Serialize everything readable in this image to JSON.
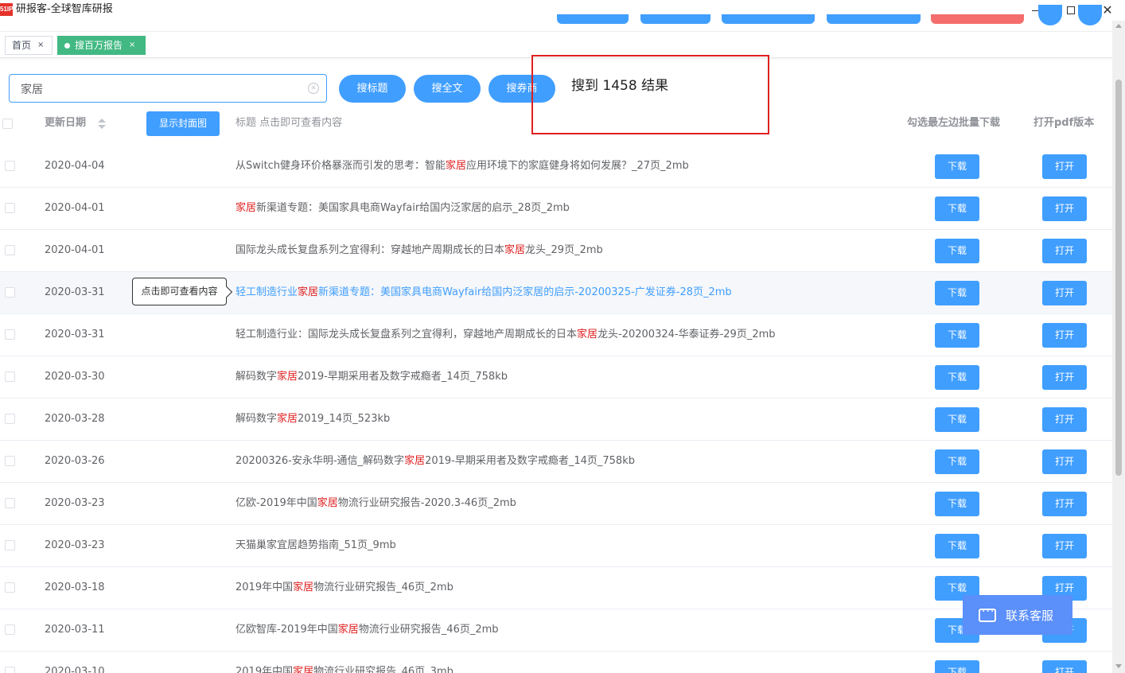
{
  "window": {
    "logo_text": "51IP",
    "title": "研报客-全球智库研报",
    "close_glyph": "✕"
  },
  "tabs": [
    {
      "label": "首页",
      "close": "×"
    },
    {
      "label": "搜百万报告",
      "close": "×",
      "active": true
    }
  ],
  "search": {
    "value": "家居",
    "clear_glyph": "×",
    "btn_title": "搜标题",
    "btn_fulltext": "搜全文",
    "btn_broker": "搜券商",
    "result_text": "搜到 1458 结果"
  },
  "table": {
    "col_date": "更新日期",
    "cover_button": "显示封面图",
    "col_title": "标题 点击即可查看内容",
    "col_batch": "勾选最左边批量下载",
    "col_pdf": "打开pdf版本",
    "download_label": "下载",
    "open_label": "打开",
    "tooltip": "点击即可查看内容",
    "rows": [
      {
        "date": "2020-04-04",
        "pre": "从Switch健身环价格暴涨而引发的思考：智能",
        "hl": "家居",
        "post": "应用环境下的家庭健身将如何发展？_27页_2mb"
      },
      {
        "date": "2020-04-01",
        "pre": "",
        "hl": "家居",
        "post": "新渠道专题：美国家具电商Wayfair给国内泛家居的启示_28页_2mb"
      },
      {
        "date": "2020-04-01",
        "pre": "国际龙头成长复盘系列之宜得利：穿越地产周期成长的日本",
        "hl": "家居",
        "post": "龙头_29页_2mb"
      },
      {
        "date": "2020-03-31",
        "pre": "轻工制造行业",
        "hl": "家居",
        "post": "新渠道专题：美国家具电商Wayfair给国内泛家居的启示-20200325-广发证券-28页_2mb",
        "hover": true
      },
      {
        "date": "2020-03-31",
        "pre": "轻工制造行业：国际龙头成长复盘系列之宜得利，穿越地产周期成长的日本",
        "hl": "家居",
        "post": "龙头-20200324-华泰证券-29页_2mb"
      },
      {
        "date": "2020-03-30",
        "pre": "解码数字",
        "hl": "家居",
        "post": "2019-早期采用者及数字戒瘾者_14页_758kb"
      },
      {
        "date": "2020-03-28",
        "pre": "解码数字",
        "hl": "家居",
        "post": "2019_14页_523kb"
      },
      {
        "date": "2020-03-26",
        "pre": "20200326-安永华明-通信_解码数字",
        "hl": "家居",
        "post": "2019-早期采用者及数字戒瘾者_14页_758kb"
      },
      {
        "date": "2020-03-23",
        "pre": "亿欧-2019年中国",
        "hl": "家居",
        "post": "物流行业研究报告-2020.3-46页_2mb"
      },
      {
        "date": "2020-03-23",
        "pre": "天猫巢家宜居趋势指南_51页_9mb",
        "hl": "",
        "post": ""
      },
      {
        "date": "2020-03-18",
        "pre": "2019年中国",
        "hl": "家居",
        "post": "物流行业研究报告_46页_2mb"
      },
      {
        "date": "2020-03-11",
        "pre": "亿欧智库-2019年中国",
        "hl": "家居",
        "post": "物流行业研究报告_46页_2mb"
      },
      {
        "date": "2020-03-10",
        "pre": "2019年中国",
        "hl": "家居",
        "post": "物流行业研究报告_46页_3mb"
      }
    ]
  },
  "contact": {
    "label": "联系客服"
  },
  "colors": {
    "primary": "#409eff",
    "highlight": "#e02020",
    "tab_active": "#42b983",
    "contact": "#5b8ff9"
  }
}
